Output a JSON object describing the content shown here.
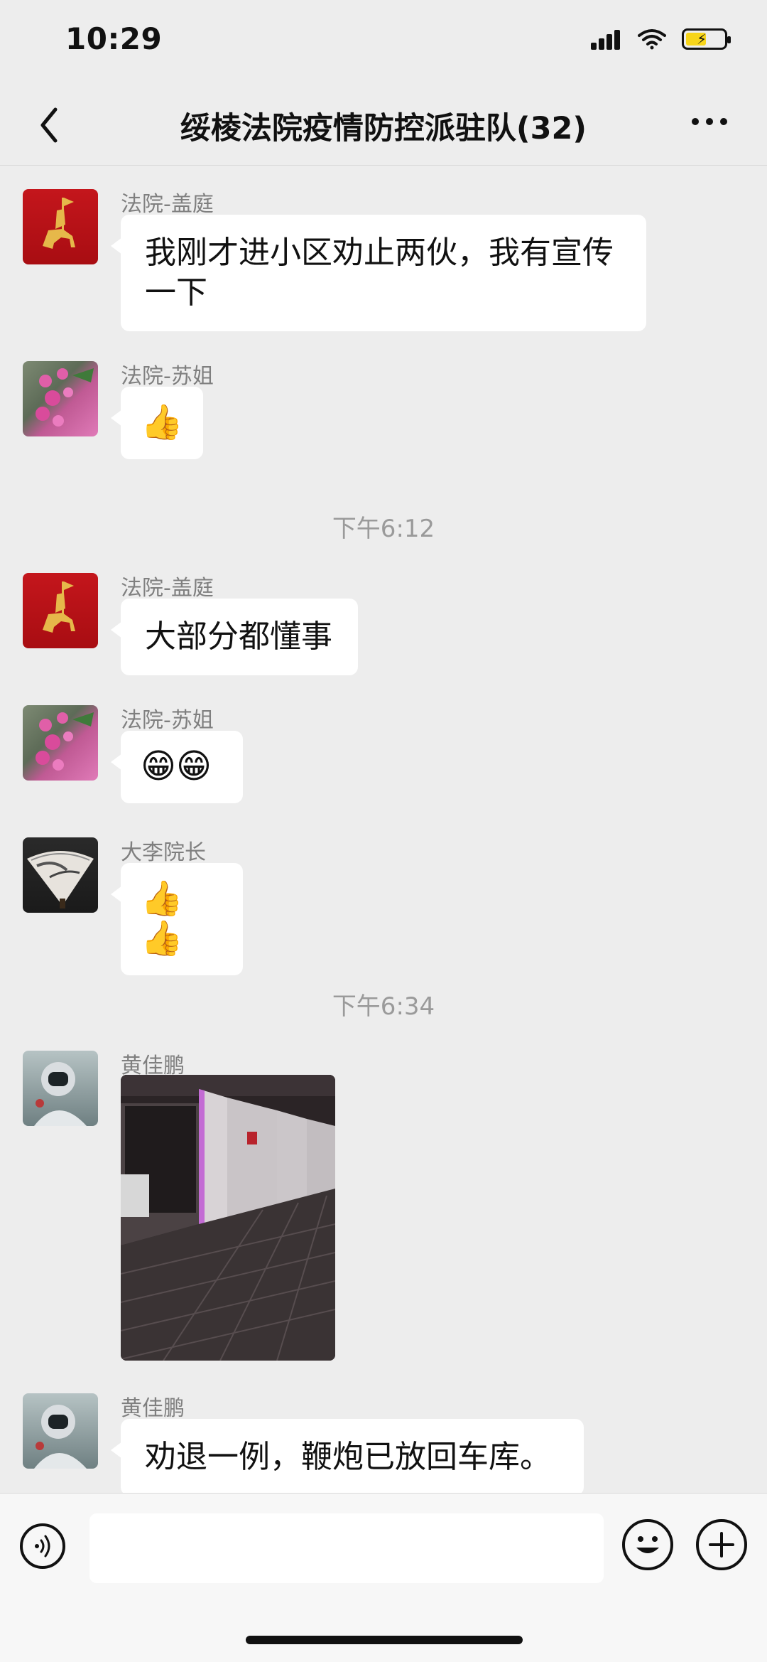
{
  "status": {
    "time": "10:29"
  },
  "header": {
    "title": "绥棱法院疫情防控派驻队(32)"
  },
  "messages": [
    {
      "sender": "法院-盖庭",
      "text": "我刚才进小区劝止两伙，我有宣传一下"
    },
    {
      "sender": "法院-苏姐",
      "text": "👍"
    },
    {
      "timestamp": "下午6:12"
    },
    {
      "sender": "法院-盖庭",
      "text": "大部分都懂事"
    },
    {
      "sender": "法院-苏姐",
      "text": "😁😁"
    },
    {
      "sender": "大李院长",
      "text": "👍👍"
    },
    {
      "timestamp": "下午6:34"
    },
    {
      "sender": "黄佳鹏",
      "image": "night-garage-photo"
    },
    {
      "sender": "黄佳鹏",
      "text": "劝退一例，鞭炮已放回车库。"
    }
  ],
  "icons": {
    "back": "chevron-left-icon",
    "more": "more-icon",
    "voice": "voice-icon",
    "emoji": "emoji-icon",
    "plus": "plus-icon"
  },
  "colors": {
    "bubble": "#ffffff",
    "background": "#ededed",
    "sender_text": "#7f7f7f"
  }
}
